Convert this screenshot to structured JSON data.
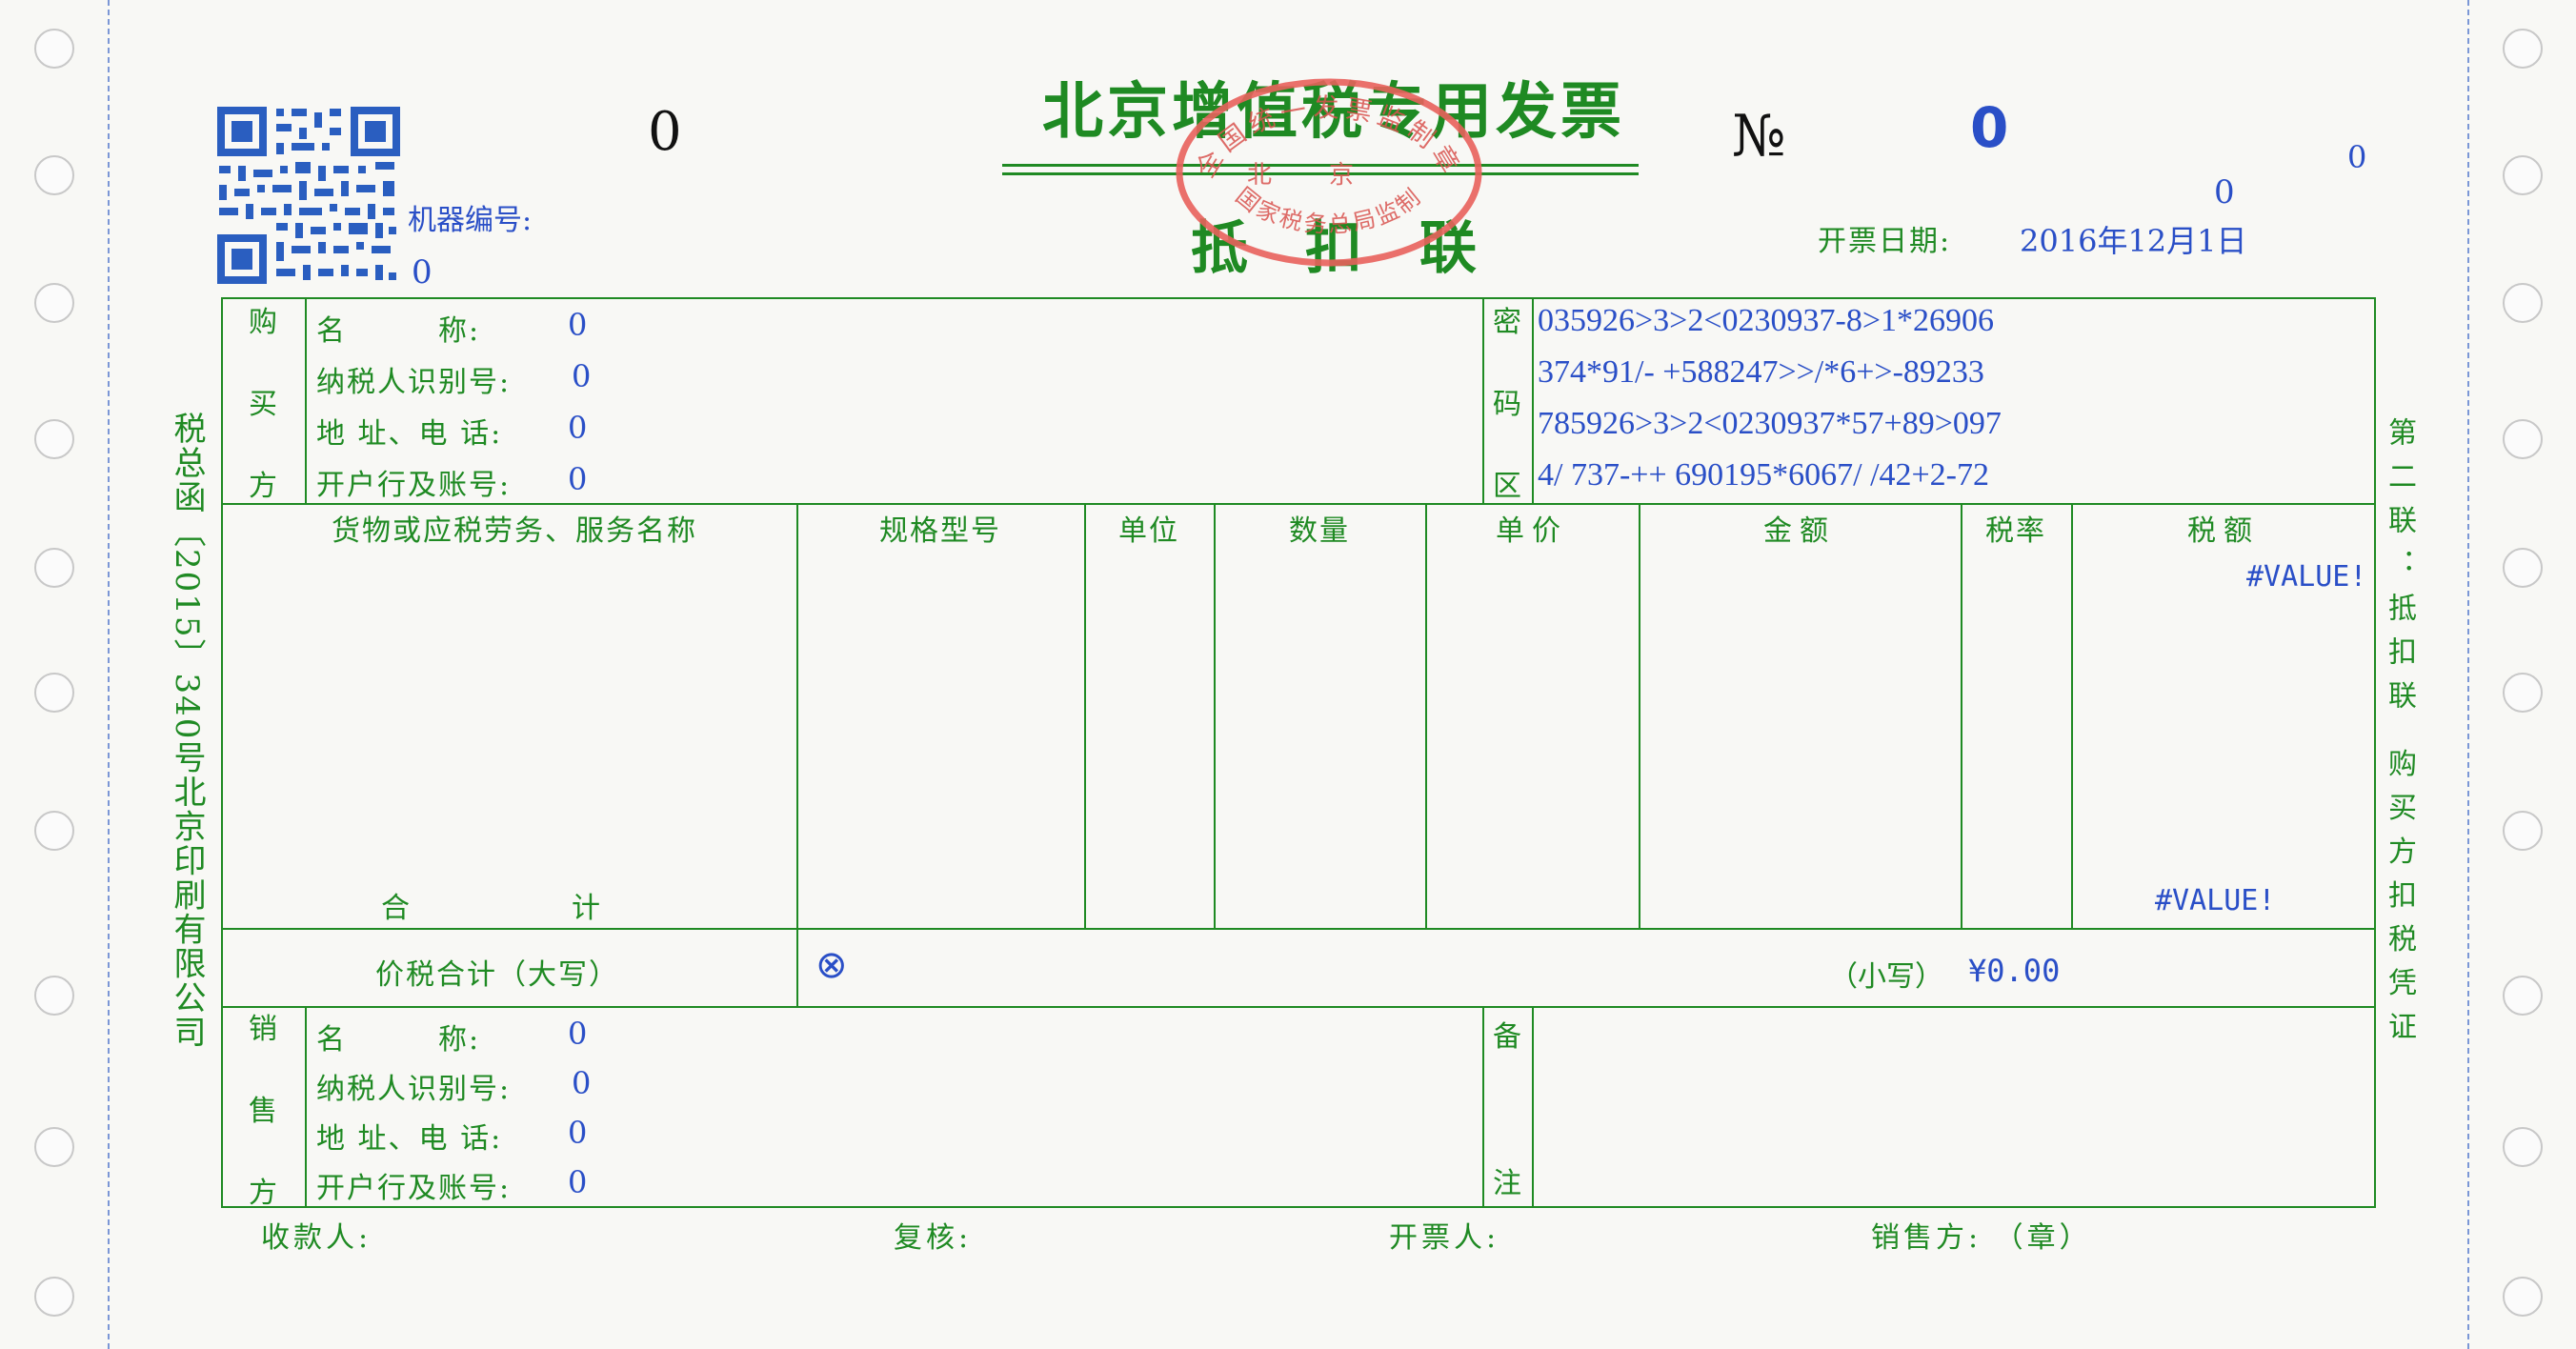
{
  "invoice": {
    "title": "北京增值税专用发票",
    "subtitle": "抵扣联",
    "invoice_code": "0",
    "number_symbol": "№",
    "invoice_number": "0",
    "right_small_1": "0",
    "right_small_2": "0",
    "machine_no_label": "机器编号:",
    "machine_no_value": "0",
    "issue_date_label": "开票日期:",
    "issue_date_value": "2016年12月1日",
    "left_vertical_text": "税总函〔2015〕340号北京印刷有限公司",
    "right_vertical_text": "第二联：抵扣联  购买方扣税凭证"
  },
  "seal": {
    "top_text": "全国统一发票监制章",
    "middle_text": "北京",
    "bottom_text": "国家税务总局监制"
  },
  "buyer": {
    "section_label": [
      "购",
      "买",
      "方"
    ],
    "name_label": "名　　　称:",
    "name_value": "0",
    "tax_id_label": "纳税人识别号:",
    "tax_id_value": "0",
    "address_label": "地 址、电 话:",
    "address_value": "0",
    "bank_label": "开户行及账号:",
    "bank_value": "0"
  },
  "cipher": {
    "section_label": [
      "密",
      "码",
      "区"
    ],
    "lines": [
      "035926>3>2<0230937-8>1*26906",
      "374*91/- +588247>>/*6+>-89233",
      "785926>3>2<0230937*57+89>097",
      "4/ 737-++ 690195*6067/ /42+2-72"
    ]
  },
  "items": {
    "headers": [
      "货物或应税劳务、服务名称",
      "规格型号",
      "单位",
      "数量",
      "单价",
      "金额",
      "税率",
      "税额"
    ],
    "tax_value_top": "#VALUE!",
    "total_label": "合　　　　计",
    "tax_value_total": "#VALUE!"
  },
  "total_in_words": {
    "label": "价税合计（大写）",
    "symbol": "⊗",
    "small_label": "（小写）",
    "small_value": "¥0.00"
  },
  "seller": {
    "section_label": [
      "销",
      "售",
      "方"
    ],
    "name_label": "名　　　称:",
    "name_value": "0",
    "tax_id_label": "纳税人识别号:",
    "tax_id_value": "0",
    "address_label": "地 址、电 话:",
    "address_value": "0",
    "bank_label": "开户行及账号:",
    "bank_value": "0"
  },
  "remarks": {
    "section_label": [
      "备",
      "注"
    ]
  },
  "footer": {
    "payee": "收款人:",
    "reviewer": "复核:",
    "drawer": "开票人:",
    "seller_seal": "销售方: （章）"
  },
  "colors": {
    "print_green": "#1f8a23",
    "data_blue": "#2a4fc7",
    "seal_red": "#e8615c"
  }
}
